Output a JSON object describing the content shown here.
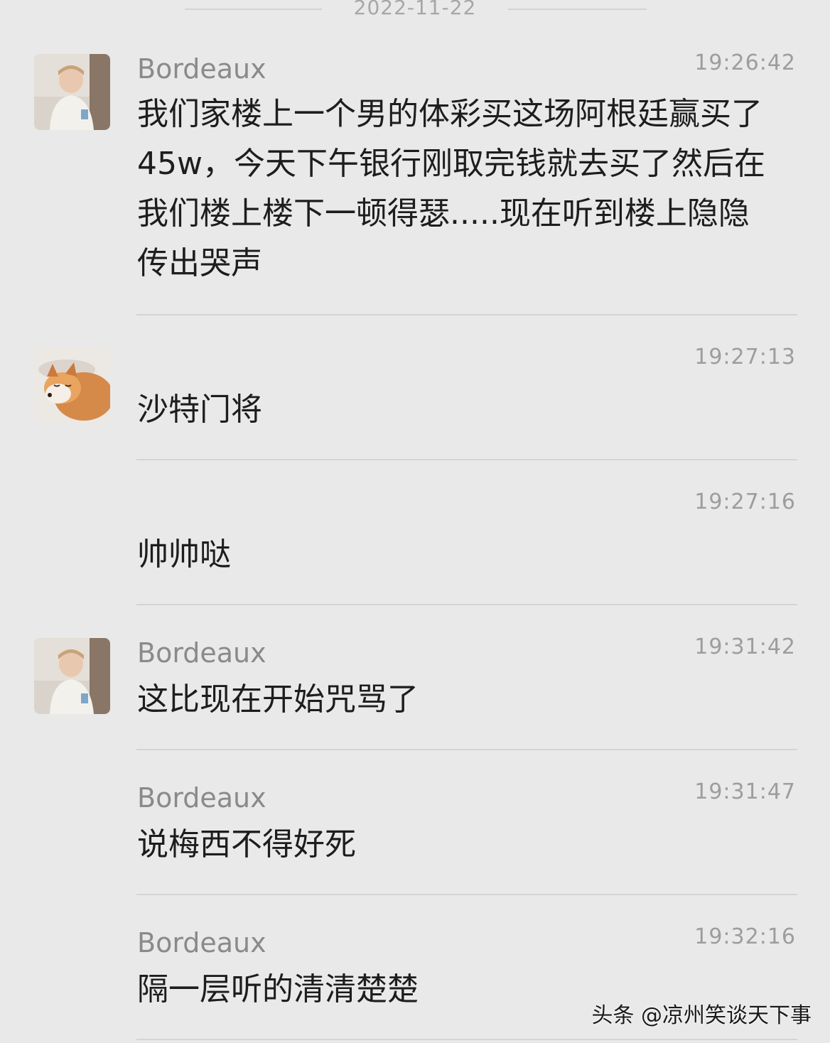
{
  "date_header": "2022-11-22",
  "messages": [
    {
      "sender": "Bordeaux",
      "time": "19:26:42",
      "text": "我们家楼上一个男的体彩买这场阿根廷赢买了45w，今天下午银行刚取完钱就去买了然后在我们楼上楼下一顿得瑟.....现在听到楼上隐隐传出哭声",
      "avatar": "boy-avatar-icon"
    },
    {
      "sender": "",
      "time": "19:27:13",
      "text": "沙特门将",
      "avatar": "fox-avatar-icon"
    },
    {
      "sender": "",
      "time": "19:27:16",
      "text": "帅帅哒",
      "avatar": ""
    },
    {
      "sender": "Bordeaux",
      "time": "19:31:42",
      "text": "这比现在开始咒骂了",
      "avatar": "boy-avatar-icon"
    },
    {
      "sender": "Bordeaux",
      "time": "19:31:47",
      "text": "说梅西不得好死",
      "avatar": ""
    },
    {
      "sender": "Bordeaux",
      "time": "19:32:16",
      "text": "隔一层听的清清楚楚",
      "avatar": ""
    }
  ],
  "watermark": "头条 @凉州笑谈天下事"
}
